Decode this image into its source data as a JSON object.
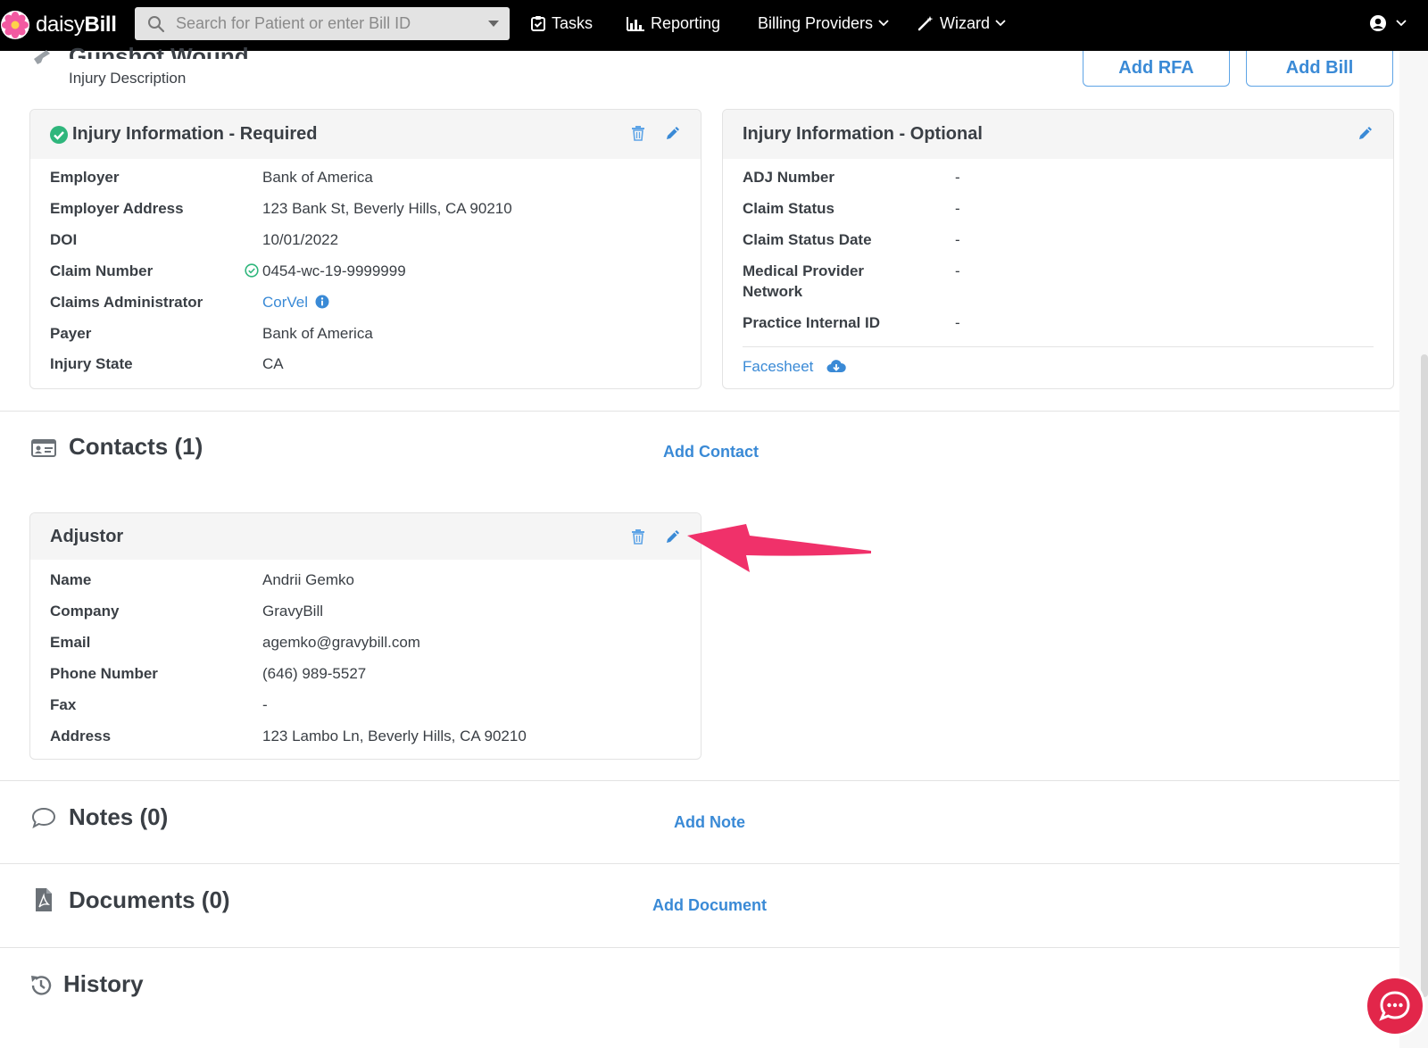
{
  "nav": {
    "brand_prefix": "daisy",
    "brand_suffix": "Bill",
    "search_placeholder": "Search for Patient or enter Bill ID",
    "tasks": "Tasks",
    "reporting": "Reporting",
    "billing_providers": "Billing Providers",
    "wizard": "Wizard"
  },
  "header": {
    "title": "Gunshot Wound",
    "subtitle": "Injury Description",
    "add_rfa": "Add RFA",
    "add_bill": "Add Bill"
  },
  "injury_required": {
    "title": "Injury Information - Required",
    "rows": [
      {
        "label": "Employer",
        "value": "Bank of America"
      },
      {
        "label": "Employer Address",
        "value": "123 Bank St, Beverly Hills, CA 90210"
      },
      {
        "label": "DOI",
        "value": "10/01/2022"
      },
      {
        "label": "Claim Number",
        "value": "0454-wc-19-9999999"
      },
      {
        "label": "Claims Administrator",
        "value": "CorVel"
      },
      {
        "label": "Payer",
        "value": "Bank of America"
      },
      {
        "label": "Injury State",
        "value": "CA"
      }
    ]
  },
  "injury_optional": {
    "title": "Injury Information - Optional",
    "rows": [
      {
        "label": "ADJ Number",
        "value": "-"
      },
      {
        "label": "Claim Status",
        "value": "-"
      },
      {
        "label": "Claim Status Date",
        "value": "-"
      },
      {
        "label": "Medical Provider Network",
        "value": "-"
      },
      {
        "label": "Practice Internal ID",
        "value": "-"
      }
    ],
    "facesheet": "Facesheet"
  },
  "contacts": {
    "title": "Contacts (1)",
    "add": "Add Contact",
    "card": {
      "title": "Adjustor",
      "rows": [
        {
          "label": "Name",
          "value": "Andrii Gemko"
        },
        {
          "label": "Company",
          "value": "GravyBill"
        },
        {
          "label": "Email",
          "value": "agemko@gravybill.com"
        },
        {
          "label": "Phone Number",
          "value": "(646) 989-5527"
        },
        {
          "label": "Fax",
          "value": "-"
        },
        {
          "label": "Address",
          "value": "123 Lambo Ln, Beverly Hills, CA 90210"
        }
      ]
    }
  },
  "notes": {
    "title": "Notes (0)",
    "add": "Add Note"
  },
  "documents": {
    "title": "Documents (0)",
    "add": "Add Document"
  },
  "history": {
    "title": "History"
  },
  "colors": {
    "accent": "#3a8ad6",
    "arrow": "#f0316a",
    "success": "#2fb67c",
    "topbar": "#000000"
  }
}
